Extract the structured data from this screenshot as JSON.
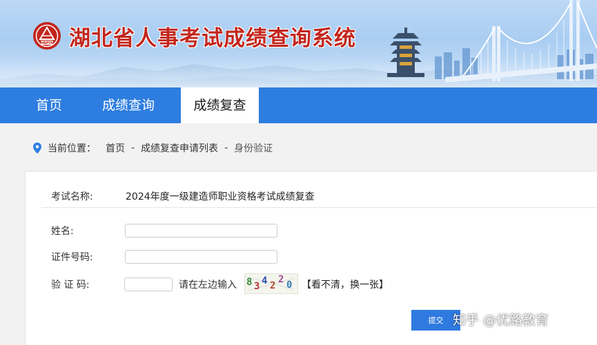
{
  "header": {
    "site_title": "湖北省人事考试成绩查询系统",
    "logo_text": "HBPTA"
  },
  "nav": {
    "items": [
      {
        "label": "首页",
        "active": false
      },
      {
        "label": "成绩查询",
        "active": false
      },
      {
        "label": "成绩复查",
        "active": true
      }
    ]
  },
  "breadcrumb": {
    "prefix": "当前位置：",
    "items": [
      "首页",
      "成绩复查申请列表",
      "身份验证"
    ],
    "separator": "-"
  },
  "form": {
    "exam_label": "考试名称:",
    "exam_value": "2024年度一级建造师职业资格考试成绩复查",
    "name_label": "姓名:",
    "name_value": "",
    "id_label": "证件号码:",
    "id_value": "",
    "captcha_label": "验 证 码:",
    "captcha_value": "",
    "captcha_hint": "请在左边输入",
    "captcha_chars": [
      "8",
      "3",
      "4",
      "2",
      "2",
      "0"
    ],
    "refresh_text": "【看不清，换一张】",
    "submit_label": "提交"
  },
  "watermark": "知乎 @优路教育",
  "colors": {
    "nav_bg": "#2e7de0",
    "title_red": "#c3261d",
    "button_blue": "#2f7ae0"
  }
}
